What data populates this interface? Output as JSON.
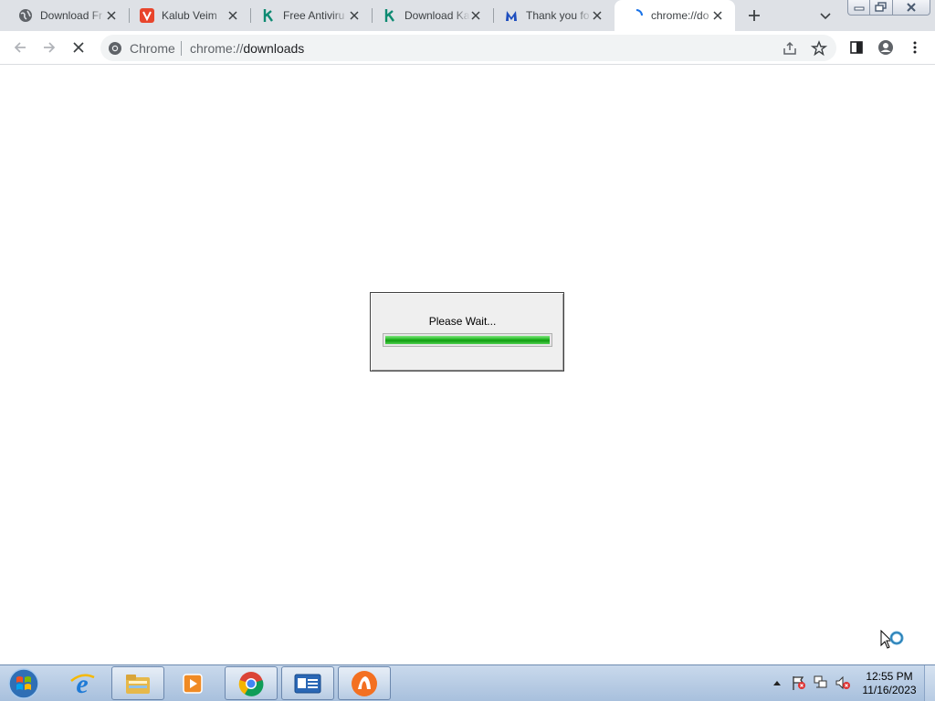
{
  "browser": {
    "tabs": [
      {
        "title": "Download Fr",
        "icon": "globe-icon",
        "active": false
      },
      {
        "title": "Kalub Veim",
        "icon": "v-logo-icon",
        "active": false
      },
      {
        "title": "Free Antiviru",
        "icon": "kaspersky-k-icon",
        "active": false
      },
      {
        "title": "Download Ka",
        "icon": "kaspersky-k-icon",
        "active": false
      },
      {
        "title": "Thank you fo",
        "icon": "malwarebytes-icon",
        "active": false
      },
      {
        "title": "chrome://do",
        "icon": "loading-spinner-icon",
        "active": true
      }
    ],
    "address": {
      "chip_label": "Chrome",
      "url_scheme": "chrome://",
      "url_host": "downloads"
    }
  },
  "dialog": {
    "message": "Please Wait...",
    "progress": 1.0
  },
  "taskbar": {
    "pinned": [
      "windows-start-icon",
      "internet-explorer-icon",
      "file-explorer-icon",
      "media-player-icon",
      "chrome-icon",
      "outlook-card-icon",
      "avast-icon"
    ],
    "clock": {
      "time": "12:55 PM",
      "date": "11/16/2023"
    }
  },
  "colors": {
    "tab_strip": "#dee1e6",
    "omnibox": "#f1f3f4",
    "progress_green": "#1fb31f",
    "taskbar": "#b7cbe3"
  }
}
